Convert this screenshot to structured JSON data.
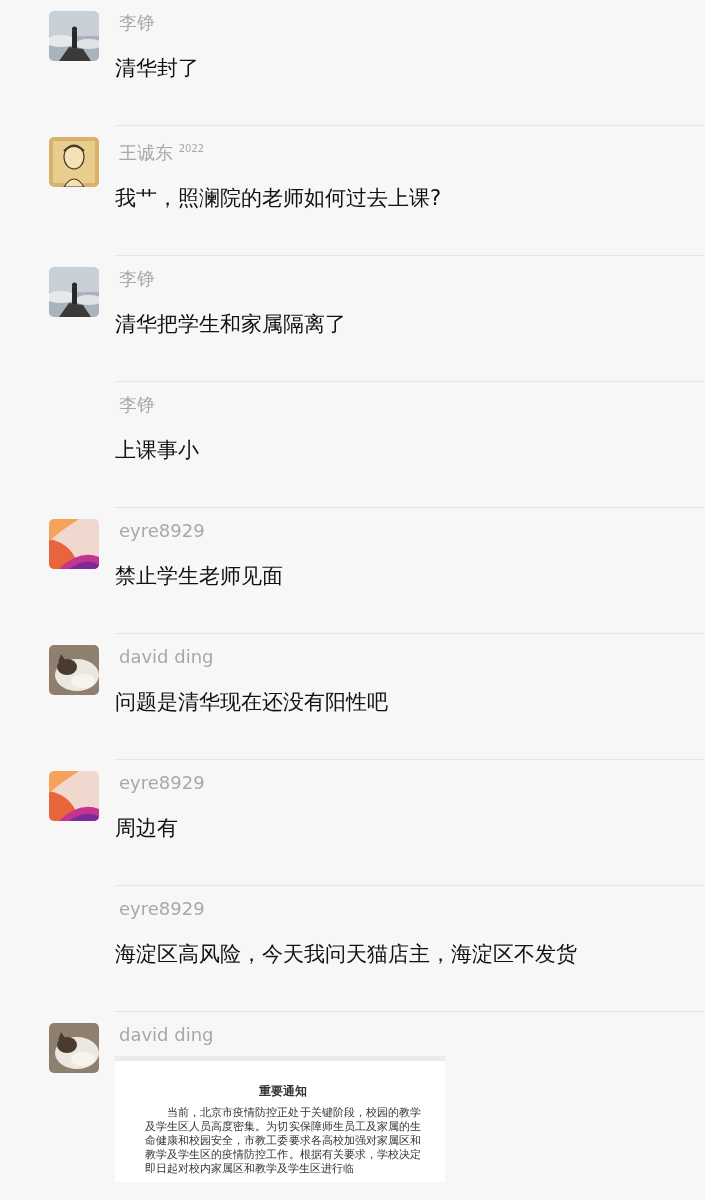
{
  "messages": [
    {
      "sender": "李铮",
      "text": "清华封了"
    },
    {
      "sender": "王诚东 $^{2022}$",
      "text": "我艹，照澜院的老师如何过去上课?"
    },
    {
      "sender": "李铮",
      "text": "清华把学生和家属隔离了"
    },
    {
      "sender": "李铮",
      "text": "上课事小"
    },
    {
      "sender": "eyre8929",
      "text": "禁止学生老师见面"
    },
    {
      "sender": "david ding",
      "text": "问题是清华现在还没有阳性吧"
    },
    {
      "sender": "eyre8929",
      "text": "周边有"
    },
    {
      "sender": "eyre8929",
      "text": "海淀区高风险，今天我问天猫店主，海淀区不发货"
    },
    {
      "sender": "david ding",
      "document": {
        "title": "重要通知",
        "body": "当前，北京市疫情防控正处于关键阶段，校园的教学及学生区人员高度密集。为切实保障师生员工及家属的生命健康和校园安全，市教工委要求各高校加强对家属区和教学及学生区的疫情防控工作。根据有关要求，学校决定即日起对校内家属区和教学及学生区进行临"
      }
    }
  ]
}
